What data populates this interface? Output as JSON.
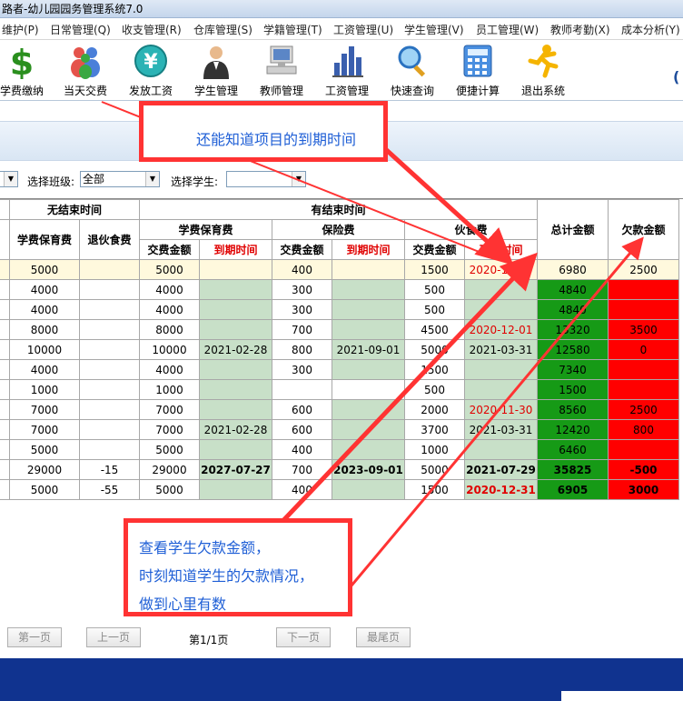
{
  "window": {
    "title": "路者-幼儿园园务管理系统7.0"
  },
  "menu": [
    "维护(P)",
    "日常管理(Q)",
    "收支管理(R)",
    "仓库管理(S)",
    "学籍管理(T)",
    "工资管理(U)",
    "学生管理(V)",
    "员工管理(W)",
    "教师考勤(X)",
    "成本分析(Y)"
  ],
  "toolbar": [
    {
      "label": "学费缴纳",
      "icon": "dollar-icon"
    },
    {
      "label": "当天交费",
      "icon": "people-icon"
    },
    {
      "label": "发放工资",
      "icon": "yen-coin-icon"
    },
    {
      "label": "学生管理",
      "icon": "student-icon"
    },
    {
      "label": "教师管理",
      "icon": "computer-icon"
    },
    {
      "label": "工资管理",
      "icon": "bar-chart-icon"
    },
    {
      "label": "快速查询",
      "icon": "magnifier-icon"
    },
    {
      "label": "便捷计算",
      "icon": "calculator-icon"
    },
    {
      "label": "退出系统",
      "icon": "runner-icon"
    }
  ],
  "toolbar_tail": "(",
  "filter": {
    "class_label": "选择班级:",
    "class_value": "全部",
    "student_label": "选择学生:",
    "student_value": ""
  },
  "table": {
    "group_no_end": "无结束时间",
    "group_with_end": "有结束时间",
    "col_tuition_no_end": "学费保育费",
    "col_meal_refund": "退伙食费",
    "sub_tuition": "学费保育费",
    "sub_insurance": "保险费",
    "sub_meal": "伙食费",
    "pay_amount": "交费金额",
    "due_date": "到期时间",
    "col_total": "总计金额",
    "col_debt": "欠款金额",
    "rows": [
      {
        "a": "5000",
        "refund": "",
        "t_amt": "5000",
        "t_date": "",
        "i_amt": "400",
        "i_date": "",
        "m_amt": "1500",
        "m_date": "2020-11-30",
        "total": "6980",
        "debt": "2500"
      },
      {
        "a": "4000",
        "refund": "",
        "t_amt": "4000",
        "t_date": "",
        "i_amt": "300",
        "i_date": "",
        "m_amt": "500",
        "m_date": "",
        "total": "4840",
        "debt": ""
      },
      {
        "a": "4000",
        "refund": "",
        "t_amt": "4000",
        "t_date": "",
        "i_amt": "300",
        "i_date": "",
        "m_amt": "500",
        "m_date": "",
        "total": "4840",
        "debt": ""
      },
      {
        "a": "8000",
        "refund": "",
        "t_amt": "8000",
        "t_date": "",
        "i_amt": "700",
        "i_date": "",
        "m_amt": "4500",
        "m_date": "2020-12-01",
        "total": "13320",
        "debt": "3500"
      },
      {
        "a": "10000",
        "refund": "",
        "t_amt": "10000",
        "t_date": "2021-02-28",
        "i_amt": "800",
        "i_date": "2021-09-01",
        "m_amt": "5000",
        "m_date": "2021-03-31",
        "total": "12580",
        "debt": "0"
      },
      {
        "a": "4000",
        "refund": "",
        "t_amt": "4000",
        "t_date": "",
        "i_amt": "300",
        "i_date": "",
        "m_amt": "1500",
        "m_date": "",
        "total": "7340",
        "debt": ""
      },
      {
        "a": "1000",
        "refund": "",
        "t_amt": "1000",
        "t_date": "",
        "i_amt": "",
        "i_date": "",
        "m_amt": "500",
        "m_date": "",
        "total": "1500",
        "debt": ""
      },
      {
        "a": "7000",
        "refund": "",
        "t_amt": "7000",
        "t_date": "",
        "i_amt": "600",
        "i_date": "",
        "m_amt": "2000",
        "m_date": "2020-11-30",
        "total": "8560",
        "debt": "2500"
      },
      {
        "a": "7000",
        "refund": "",
        "t_amt": "7000",
        "t_date": "2021-02-28",
        "i_amt": "600",
        "i_date": "",
        "m_amt": "3700",
        "m_date": "2021-03-31",
        "total": "12420",
        "debt": "800"
      },
      {
        "a": "5000",
        "refund": "",
        "t_amt": "5000",
        "t_date": "",
        "i_amt": "400",
        "i_date": "",
        "m_amt": "1000",
        "m_date": "",
        "total": "6460",
        "debt": ""
      },
      {
        "a": "29000",
        "refund": "-15",
        "t_amt": "29000",
        "t_date": "2027-07-27",
        "i_amt": "700",
        "i_date": "2023-09-01",
        "m_amt": "5000",
        "m_date": "2021-07-29",
        "total": "35825",
        "debt": "-500"
      },
      {
        "a": "5000",
        "refund": "-55",
        "t_amt": "5000",
        "t_date": "",
        "i_amt": "400",
        "i_date": "",
        "m_amt": "1500",
        "m_date": "2020-12-31",
        "total": "6905",
        "debt": "3000"
      }
    ]
  },
  "callouts": {
    "top": "还能知道项目的到期时间",
    "bottom_line1": "查看学生欠款金额，",
    "bottom_line2": "时刻知道学生的欠款情况，",
    "bottom_line3": "做到心里有数"
  },
  "pager": {
    "first": "第一页",
    "prev": "上一页",
    "page_info": "第1/1页",
    "next": "下一页",
    "last": "最尾页"
  },
  "colors": {
    "accent_red": "#ff3333",
    "date_red": "#e00000",
    "total_green": "#169a16",
    "debt_red": "#ff0000",
    "callout_blue": "#1f5fd6",
    "bottom_band": "#10338f"
  }
}
